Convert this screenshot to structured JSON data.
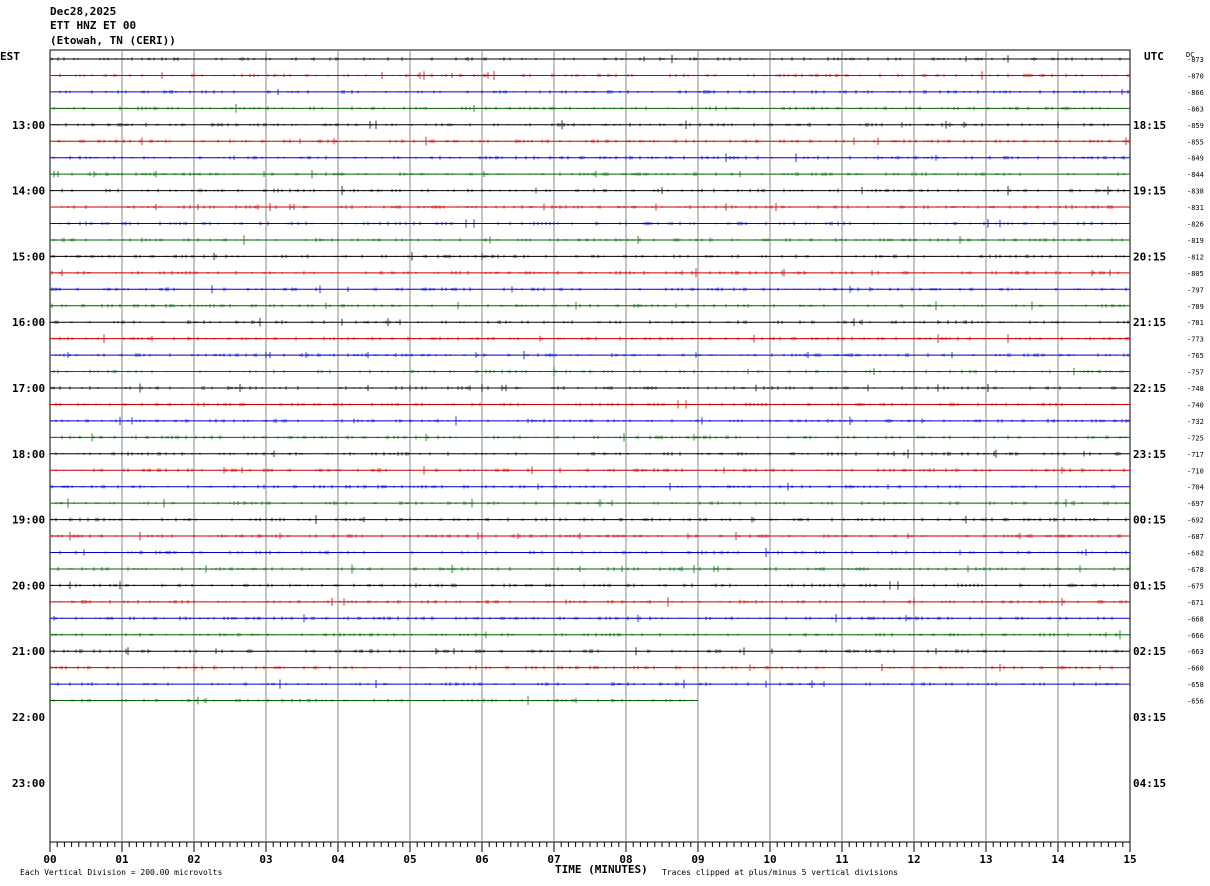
{
  "header": {
    "date": "Dec28,2025",
    "station": "ETT HNZ ET 00",
    "location": "(Etowah, TN (CERI))"
  },
  "axes": {
    "left_zone": "EST",
    "right_zone": "UTC",
    "dc_label": "DC",
    "xlabel": "TIME (MINUTES)",
    "footer_left": "Each Vertical Division =  200.00 microvolts",
    "footer_right": "Traces clipped at plus/minus 5 vertical divisions"
  },
  "chart_data": {
    "type": "line",
    "x_ticks": [
      "00",
      "01",
      "02",
      "03",
      "04",
      "05",
      "06",
      "07",
      "08",
      "09",
      "10",
      "11",
      "12",
      "13",
      "14",
      "15"
    ],
    "xlim": [
      0,
      15
    ],
    "left_hour_labels": [
      "13:00",
      "14:00",
      "15:00",
      "16:00",
      "17:00",
      "18:00",
      "19:00",
      "20:00",
      "21:00",
      "22:00",
      "23:00"
    ],
    "right_hour_labels": [
      "18:15",
      "19:15",
      "20:15",
      "21:15",
      "22:15",
      "23:15",
      "00:15",
      "01:15",
      "02:15",
      "03:15",
      "04:15"
    ],
    "dc_offsets": [
      "-873",
      "-870",
      "-866",
      "-863",
      "-859",
      "-855",
      "-849",
      "-844",
      "-838",
      "-831",
      "-826",
      "-819",
      "-812",
      "-805",
      "-797",
      "-789",
      "-781",
      "-773",
      "-765",
      "-757",
      "-748",
      "-740",
      "-732",
      "-725",
      "-717",
      "-710",
      "-704",
      "-697",
      "-692",
      "-687",
      "-682",
      "-678",
      "-675",
      "-671",
      "-668",
      "-666",
      "-663",
      "-660",
      "-658",
      "-656"
    ],
    "trace_colors": [
      "#000000",
      "#cc0000",
      "#0000cc",
      "#006600"
    ],
    "trace_count": 40,
    "last_trace_end_minute": 9,
    "grid": true
  }
}
